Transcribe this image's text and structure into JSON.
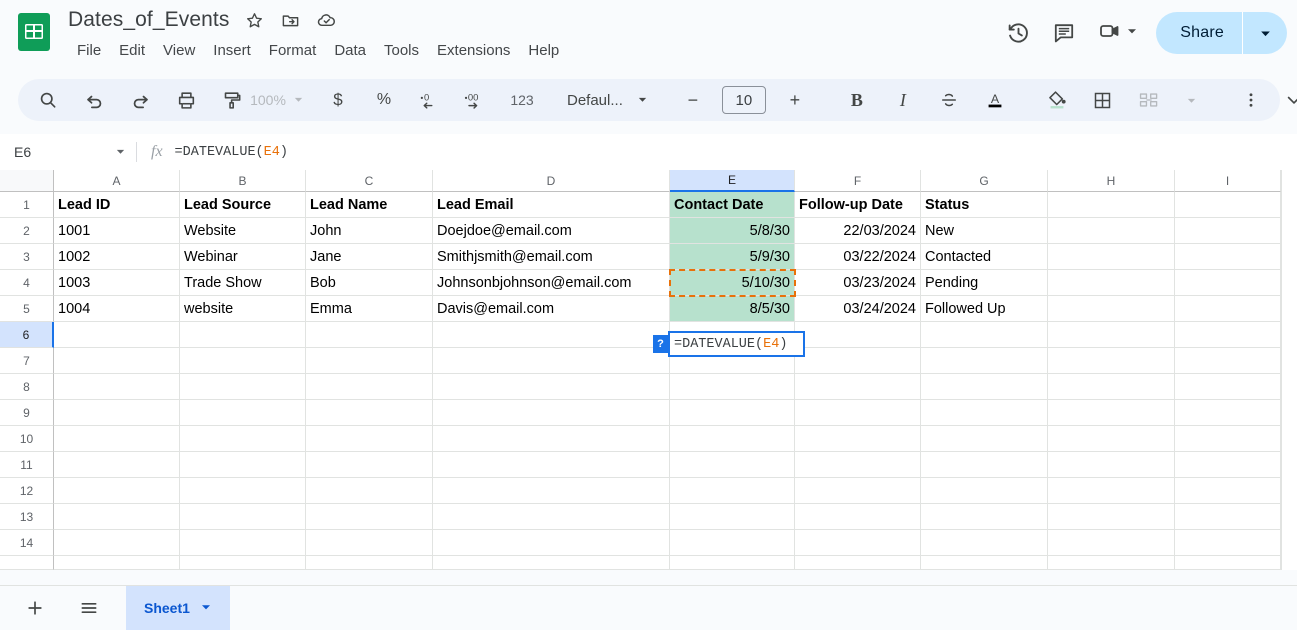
{
  "app": {
    "name": "Google Sheets"
  },
  "titlebar": {
    "doc_title": "Dates_of_Events",
    "logo_icon": "sheets-logo-icon",
    "star_icon": "star-icon",
    "move_icon": "move-to-folder-icon",
    "cloud_icon": "saved-to-drive-icon",
    "menus": [
      "File",
      "Edit",
      "View",
      "Insert",
      "Format",
      "Data",
      "Tools",
      "Extensions",
      "Help"
    ],
    "history_icon": "version-history-icon",
    "comment_icon": "comment-icon",
    "meet_icon": "video-camera-icon",
    "meet_caret": "chevron-down-icon",
    "share_label": "Share",
    "share_caret": "chevron-down-icon"
  },
  "toolbar": {
    "search_icon": "search-icon",
    "undo_icon": "undo-icon",
    "redo_icon": "redo-icon",
    "print_icon": "print-icon",
    "paint_icon": "paint-format-icon",
    "zoom_value": "100%",
    "zoom_caret": "chevron-down-icon",
    "currency_label": "$",
    "percent_label": "%",
    "dec_decrease_icon": "decrease-decimal-icon",
    "dec_increase_icon": "increase-decimal-icon",
    "number_format_label": "123",
    "font_name": "Defaul...",
    "font_caret": "chevron-down-icon",
    "font_minus": "−",
    "font_size": "10",
    "font_plus": "+",
    "bold_label": "B",
    "italic_label": "I",
    "strikethrough_icon": "strikethrough-icon",
    "text_color_label": "A",
    "fill_color_icon": "fill-color-icon",
    "borders_icon": "borders-icon",
    "merge_icon": "merge-cells-icon",
    "merge_caret": "chevron-down-icon",
    "more_icon": "more-options-icon",
    "collapse_icon": "chevron-down-icon"
  },
  "formula_bar": {
    "name_box": "E6",
    "name_caret": "chevron-down-icon",
    "fx_label": "fx",
    "formula_prefix": "=DATEVALUE(",
    "formula_ref": "E4",
    "formula_suffix": ")"
  },
  "grid": {
    "columns": [
      "A",
      "B",
      "C",
      "D",
      "E",
      "F",
      "G",
      "H",
      "I"
    ],
    "selected_column": "E",
    "selected_row": "6",
    "rows": [
      "1",
      "2",
      "3",
      "4",
      "5",
      "6",
      "7",
      "8",
      "9",
      "10",
      "11",
      "12",
      "13",
      "14"
    ],
    "headers": {
      "A": "Lead ID",
      "B": "Lead Source",
      "C": "Lead Name",
      "D": "Lead Email",
      "E": "Contact Date",
      "F": "Follow-up Date",
      "G": "Status"
    },
    "data": [
      {
        "A": "1001",
        "B": "Website",
        "C": "John",
        "D": "Doejdoe@email.com",
        "E": "5/8/30",
        "F": "22/03/2024",
        "G": "New"
      },
      {
        "A": "1002",
        "B": "Webinar",
        "C": "Jane",
        "D": "Smithjsmith@email.com",
        "E": "5/9/30",
        "F": "03/22/2024",
        "G": "Contacted"
      },
      {
        "A": "1003",
        "B": "Trade Show",
        "C": "Bob",
        "D": "Johnsonbjohnson@email.com",
        "E": "5/10/30",
        "F": "03/23/2024",
        "G": "Pending"
      },
      {
        "A": "1004",
        "B": "website",
        "C": "Emma",
        "D": "Davis@email.com",
        "E": "8/5/30",
        "F": "03/24/2024",
        "G": "Followed Up"
      }
    ],
    "cell_editor": {
      "cell": "E6",
      "prefix": "=DATEVALUE(",
      "ref": "E4",
      "suffix": ")",
      "help_badge": "?"
    },
    "reference_cell": "E4"
  },
  "bottom_bar": {
    "add_sheet_icon": "add-sheet-icon",
    "all_sheets_icon": "all-sheets-icon",
    "sheet_name": "Sheet1",
    "sheet_caret": "chevron-down-icon"
  },
  "colors": {
    "accent": "#1a73e8",
    "fill_green": "#b7e1cd",
    "reference_orange": "#e8710a",
    "selection_blue": "#d3e3fd",
    "share_blue": "#c2e7ff"
  }
}
